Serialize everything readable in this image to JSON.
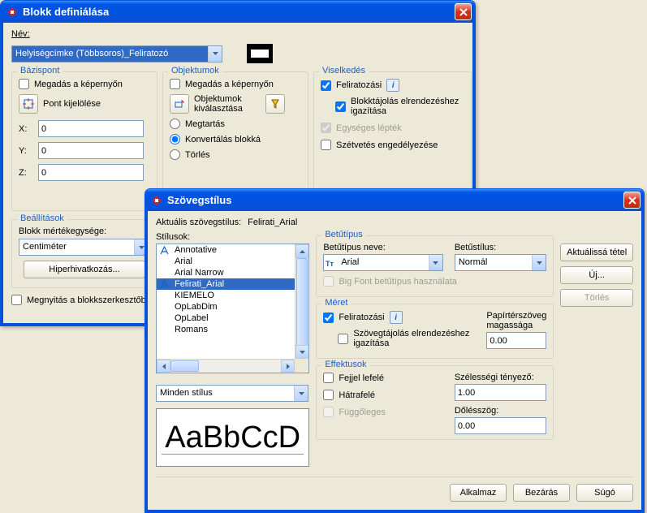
{
  "win1": {
    "title": "Blokk definiálása",
    "name_label": "Név:",
    "name_value": "Helyiségcímke (Többsoros)_Feliratozó",
    "basepoint": {
      "legend": "Bázispont",
      "on_screen": "Megadás a képernyőn",
      "pick": "Pont kijelölése",
      "x_label": "X:",
      "y_label": "Y:",
      "z_label": "Z:",
      "x": "0",
      "y": "0",
      "z": "0"
    },
    "objects": {
      "legend": "Objektumok",
      "on_screen": "Megadás a képernyőn",
      "select": "Objektumok kiválasztása",
      "retain": "Megtartás",
      "convert": "Konvertálás blokká",
      "delete": "Törlés"
    },
    "behavior": {
      "legend": "Viselkedés",
      "annotative": "Feliratozási",
      "match": "Blokktájolás elrendezéshez igazítása",
      "uniform": "Egységes lépték",
      "explode": "Szétvetés engedélyezése"
    },
    "settings": {
      "legend": "Beállítások",
      "units_label": "Blokk mértékegysége:",
      "units_value": "Centiméter",
      "hyperlink": "Hiperhivatkozás..."
    },
    "open_in_editor": "Megnyitás a blokkszerkesztőben"
  },
  "win2": {
    "title": "Szövegstílus",
    "current_label": "Aktuális szövegstílus:",
    "current_value": "Felirati_Arial",
    "styles_label": "Stílusok:",
    "styles": [
      "Annotative",
      "Arial",
      "Arial Narrow",
      "Felirati_Arial",
      "KIEMELO",
      "OpLabDim",
      "OpLabel",
      "Romans"
    ],
    "style_selected_index": 3,
    "annotative_indices": [
      0,
      3
    ],
    "filter_value": "Minden stílus",
    "preview_text": "AaBbCcD",
    "font": {
      "legend": "Betűtípus",
      "name_label": "Betűtípus neve:",
      "name_value": "Arial",
      "style_label": "Betűstílus:",
      "style_value": "Normál",
      "bigfont": "Big Font betűtípus használata"
    },
    "size": {
      "legend": "Méret",
      "annotative": "Feliratozási",
      "match": "Szövegtájolás elrendezéshez igazítása",
      "height_label": "Papírtérszöveg magassága",
      "height_value": "0.00"
    },
    "effects": {
      "legend": "Effektusok",
      "upside": "Fejjel lefelé",
      "backwards": "Hátrafelé",
      "vertical": "Függőleges",
      "width_label": "Szélességi tényező:",
      "width_value": "1.00",
      "oblique_label": "Dőlésszög:",
      "oblique_value": "0.00"
    },
    "buttons": {
      "setcurrent": "Aktuálissá tétel",
      "new": "Új...",
      "delete": "Törlés",
      "apply": "Alkalmaz",
      "close": "Bezárás",
      "help": "Súgó"
    }
  }
}
